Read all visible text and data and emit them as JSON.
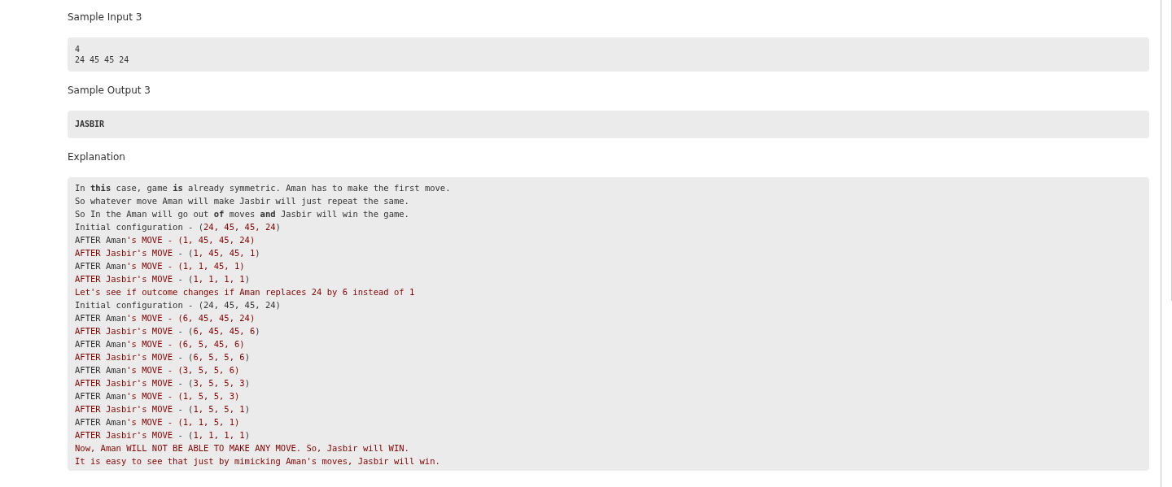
{
  "sections": [
    {
      "heading": "Sample Input 3",
      "lines": [
        [
          {
            "text": "4",
            "kind": "plain"
          }
        ],
        [
          {
            "text": "24 45 45 24",
            "kind": "plain"
          }
        ]
      ]
    },
    {
      "heading": "Sample Output 3",
      "lines": [
        [
          {
            "text": "JASBIR",
            "kind": "bold"
          }
        ]
      ]
    },
    {
      "heading": "Explanation",
      "lines": [
        [
          {
            "text": "In ",
            "kind": "plain"
          },
          {
            "text": "this",
            "kind": "bold"
          },
          {
            "text": " case, game ",
            "kind": "plain"
          },
          {
            "text": "is",
            "kind": "bold"
          },
          {
            "text": " already symmetric. Aman has to make the first move.",
            "kind": "plain"
          }
        ],
        [
          {
            "text": "So whatever move Aman will make Jasbir will just repeat the same.",
            "kind": "plain"
          }
        ],
        [
          {
            "text": "So In the Aman will go out ",
            "kind": "plain"
          },
          {
            "text": "of",
            "kind": "bold"
          },
          {
            "text": " moves ",
            "kind": "plain"
          },
          {
            "text": "and",
            "kind": "bold"
          },
          {
            "text": " Jasbir will win the game.",
            "kind": "plain"
          }
        ],
        [
          {
            "text": "Initial configuration - (",
            "kind": "plain"
          },
          {
            "text": "24, 45, 45, 24",
            "kind": "string"
          },
          {
            "text": ")",
            "kind": "plain"
          }
        ],
        [
          {
            "text": "AFTER Aman",
            "kind": "plain"
          },
          {
            "text": "'s MOVE - (1, 45, 45, 24)",
            "kind": "string"
          }
        ],
        [
          {
            "text": "AFTER Jasbir's MOVE",
            "kind": "string"
          },
          {
            "text": " - (",
            "kind": "plain"
          },
          {
            "text": "1, 45, 45, 1",
            "kind": "string"
          },
          {
            "text": ")",
            "kind": "plain"
          }
        ],
        [
          {
            "text": "AFTER Aman",
            "kind": "plain"
          },
          {
            "text": "'s MOVE - (1, 1, 45, 1)",
            "kind": "string"
          }
        ],
        [
          {
            "text": "AFTER Jasbir's MOVE",
            "kind": "string"
          },
          {
            "text": " - (",
            "kind": "plain"
          },
          {
            "text": "1, 1, 1, 1",
            "kind": "string"
          },
          {
            "text": ")",
            "kind": "plain"
          }
        ],
        [
          {
            "text": "Let's see if outcome changes if Aman replaces 24 by 6 instead of 1",
            "kind": "string"
          }
        ],
        [
          {
            "text": "Initial configuration - (24, 45, 45, 24)",
            "kind": "plain"
          }
        ],
        [
          {
            "text": "AFTER Aman",
            "kind": "plain"
          },
          {
            "text": "'s MOVE - (6, 45, 45, 24)",
            "kind": "string"
          }
        ],
        [
          {
            "text": "AFTER Jasbir's MOVE",
            "kind": "string"
          },
          {
            "text": " - (",
            "kind": "plain"
          },
          {
            "text": "6, 45, 45, 6",
            "kind": "string"
          },
          {
            "text": ")",
            "kind": "plain"
          }
        ],
        [
          {
            "text": "AFTER Aman",
            "kind": "plain"
          },
          {
            "text": "'s MOVE - (6, 5, 45, 6)",
            "kind": "string"
          }
        ],
        [
          {
            "text": "AFTER Jasbir's MOVE",
            "kind": "string"
          },
          {
            "text": " - (",
            "kind": "plain"
          },
          {
            "text": "6, 5, 5, 6",
            "kind": "string"
          },
          {
            "text": ")",
            "kind": "plain"
          }
        ],
        [
          {
            "text": "AFTER Aman",
            "kind": "plain"
          },
          {
            "text": "'s MOVE - (3, 5, 5, 6)",
            "kind": "string"
          }
        ],
        [
          {
            "text": "AFTER Jasbir's MOVE",
            "kind": "string"
          },
          {
            "text": " - (",
            "kind": "plain"
          },
          {
            "text": "3, 5, 5, 3",
            "kind": "string"
          },
          {
            "text": ")",
            "kind": "plain"
          }
        ],
        [
          {
            "text": "AFTER Aman",
            "kind": "plain"
          },
          {
            "text": "'s MOVE - (1, 5, 5, 3)",
            "kind": "string"
          }
        ],
        [
          {
            "text": "AFTER Jasbir's MOVE",
            "kind": "string"
          },
          {
            "text": " - (",
            "kind": "plain"
          },
          {
            "text": "1, 5, 5, 1",
            "kind": "string"
          },
          {
            "text": ")",
            "kind": "plain"
          }
        ],
        [
          {
            "text": "AFTER Aman",
            "kind": "plain"
          },
          {
            "text": "'s MOVE - (1, 1, 5, 1)",
            "kind": "string"
          }
        ],
        [
          {
            "text": "AFTER Jasbir's MOVE",
            "kind": "string"
          },
          {
            "text": " - (",
            "kind": "plain"
          },
          {
            "text": "1, 1, 1, 1",
            "kind": "string"
          },
          {
            "text": ")",
            "kind": "plain"
          }
        ],
        [
          {
            "text": "Now, Aman WILL NOT BE ABLE TO MAKE ANY MOVE. So, Jasbir will WIN.",
            "kind": "string"
          }
        ],
        [
          {
            "text": "It is easy to see that just by mimicking Aman's moves, Jasbir will win.",
            "kind": "string"
          }
        ]
      ]
    }
  ]
}
